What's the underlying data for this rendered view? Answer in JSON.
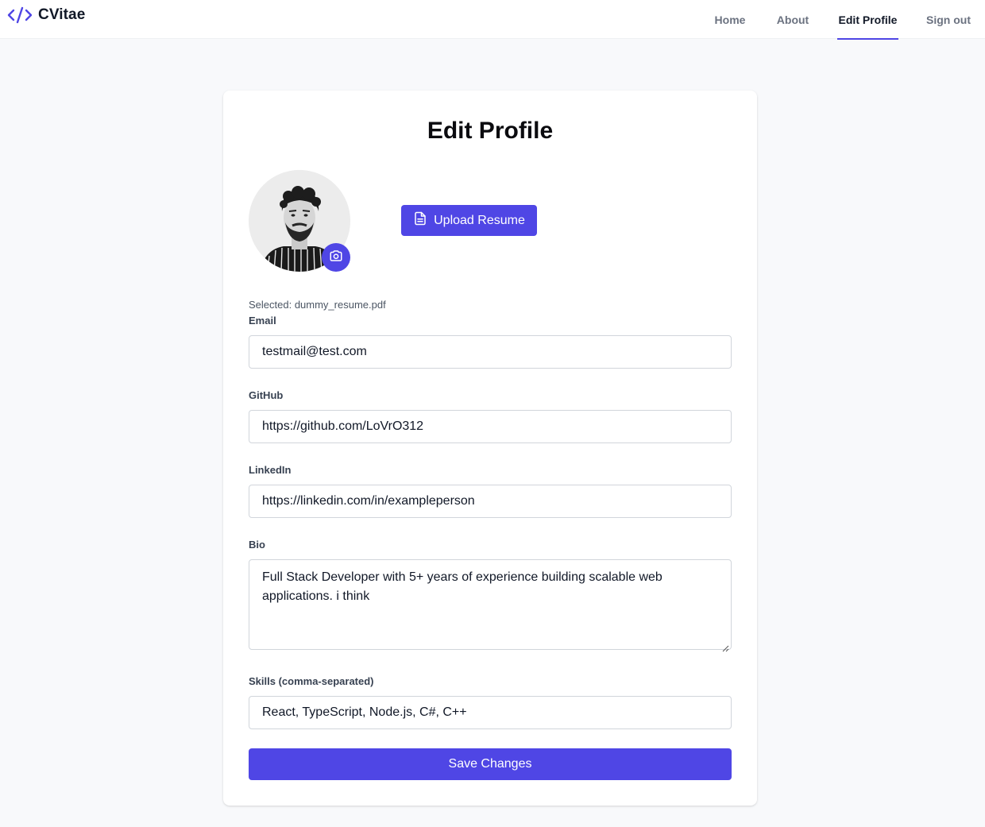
{
  "app": {
    "brand": "CVitae",
    "accent_color": "#4f46e5"
  },
  "nav": {
    "home": "Home",
    "about": "About",
    "edit_profile": "Edit Profile",
    "sign_out": "Sign out",
    "active": "edit_profile"
  },
  "page": {
    "title": "Edit Profile",
    "upload_resume_label": "Upload Resume",
    "selected_file_text": "Selected: dummy_resume.pdf"
  },
  "form": {
    "email": {
      "label": "Email",
      "value": "testmail@test.com"
    },
    "github": {
      "label": "GitHub",
      "value": "https://github.com/LoVrO312"
    },
    "linkedin": {
      "label": "LinkedIn",
      "value": "https://linkedin.com/in/exampleperson"
    },
    "bio": {
      "label": "Bio",
      "value": "Full Stack Developer with 5+ years of experience building scalable web applications. i think"
    },
    "skills": {
      "label": "Skills (comma-separated)",
      "value": "React, TypeScript, Node.js, C#, C++"
    },
    "save_label": "Save Changes"
  },
  "icons": {
    "brand": "code-icon",
    "camera": "camera-icon",
    "upload": "document-icon"
  }
}
